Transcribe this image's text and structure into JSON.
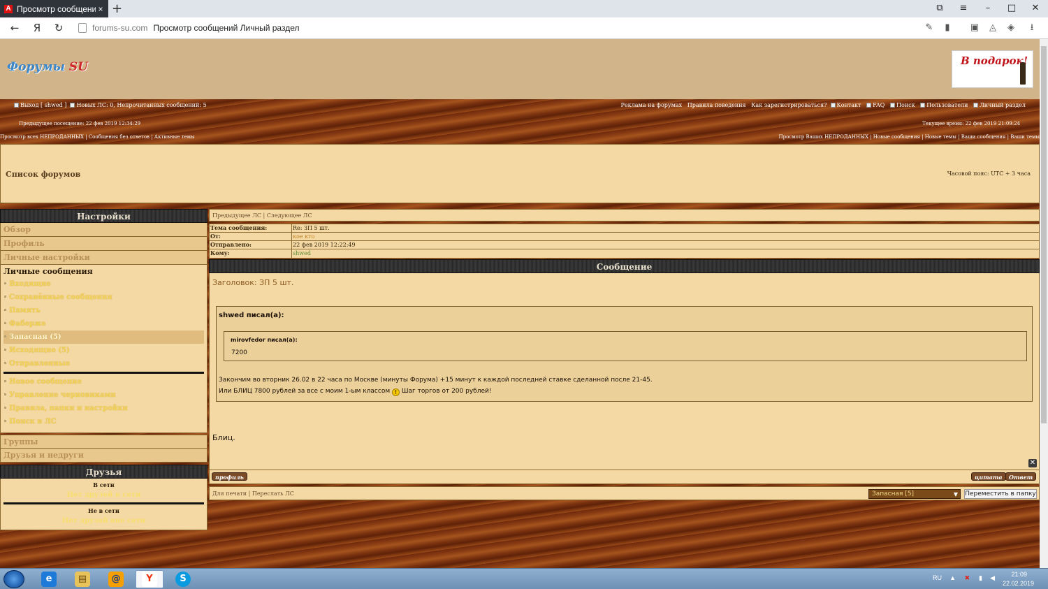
{
  "browser": {
    "tab_title": "Просмотр сообщений /",
    "tab_close": "×",
    "new_tab": "+",
    "domain": "forums-su.com",
    "page_title": "Просмотр сообщений Личный раздел"
  },
  "header": {
    "logo_main": "Форумы",
    "logo_su": "SU",
    "gift": "В подарок!"
  },
  "topnav": {
    "left": "Выход [ shwed ]",
    "new_pm": "Новых ЛС: 0, Непрочитанных сообщений: 5",
    "right_links": [
      "Реклама на форумах",
      "Правила поведения",
      "Как зарегистрироваться?"
    ],
    "right_icons": [
      "Контакт",
      "FAQ",
      "Поиск",
      "Пользователи",
      "Личный раздел"
    ]
  },
  "visits": {
    "prev": "Предыдущее посещение: 22 фев 2019 12:34:29",
    "now": "Текущее время: 22 фев 2019 21:09:24"
  },
  "quicklinks": {
    "left": "Просмотр всех НЕПРОДАННЫХ | Сообщения без ответов | Активные темы",
    "right": "Просмотр Ваших НЕПРОДАННЫХ | Новые сообщения | Новые темы | Ваши сообщения | Ваши темы"
  },
  "crumb": {
    "forum_list": "Список форумов",
    "timezone": "Часовой пояс: UTC + 3 часа"
  },
  "sidebar": {
    "title": "Настройки",
    "items_top": [
      "Обзор",
      "Профиль",
      "Личные настройки"
    ],
    "pm_header": "Личные сообщения",
    "pm_folders": [
      "Входящие",
      "Сохранённые сообщения",
      "Память",
      "Фаберже",
      "Запасная (5)",
      "Исходящие (5)",
      "Отправленные"
    ],
    "pm_actions": [
      "Новое сообщение",
      "Управление черновиками",
      "Правила, папки и настройки",
      "Поиск в ЛС"
    ],
    "items_bottom": [
      "Группы",
      "Друзья и недруги"
    ],
    "friends_title": "Друзья",
    "online_label": "В сети",
    "online_empty": "Нет друзей в сети",
    "offline_label": "Не в сети",
    "offline_empty": "Нет друзей вне сети"
  },
  "main": {
    "nav": "Предыдущее ЛС | Следующее ЛС",
    "info": [
      {
        "k": "Тема сообщения:",
        "v": "Re: ЗП 5 шт."
      },
      {
        "k": "От:",
        "v": "кое кто"
      },
      {
        "k": "Отправлено:",
        "v": "22 фев 2019 12:22:49"
      },
      {
        "k": "Кому:",
        "v": "shwed"
      }
    ],
    "message_title": "Сообщение",
    "subject_line": "Заголовок: ЗП 5 шт.",
    "quote1_author": "shwed писал(а):",
    "quote2_author": "mirovfedor писал(а):",
    "quote2_text": "7200",
    "line1": "Закончим во вторник 26.02 в 22 часа по Москве (минуты Форума) +15 минут к каждой последней ставке сделанной после 21-45.",
    "line2a": "Или БЛИЦ 7800 рублей за все с моим 1-ым классом",
    "line2b": "Шаг торгов от 200 рублей!",
    "reply_text": "Блиц.",
    "btn_profile": "профиль",
    "btn_quote": "цитата",
    "btn_reply": "Ответ",
    "bottom_links": "Для печати | Переслать ЛС",
    "folder_select": "Запасная [5]",
    "move_btn": "Переместить в папку"
  },
  "taskbar": {
    "lang": "RU",
    "time": "21:09",
    "date": "22.02.2019"
  }
}
